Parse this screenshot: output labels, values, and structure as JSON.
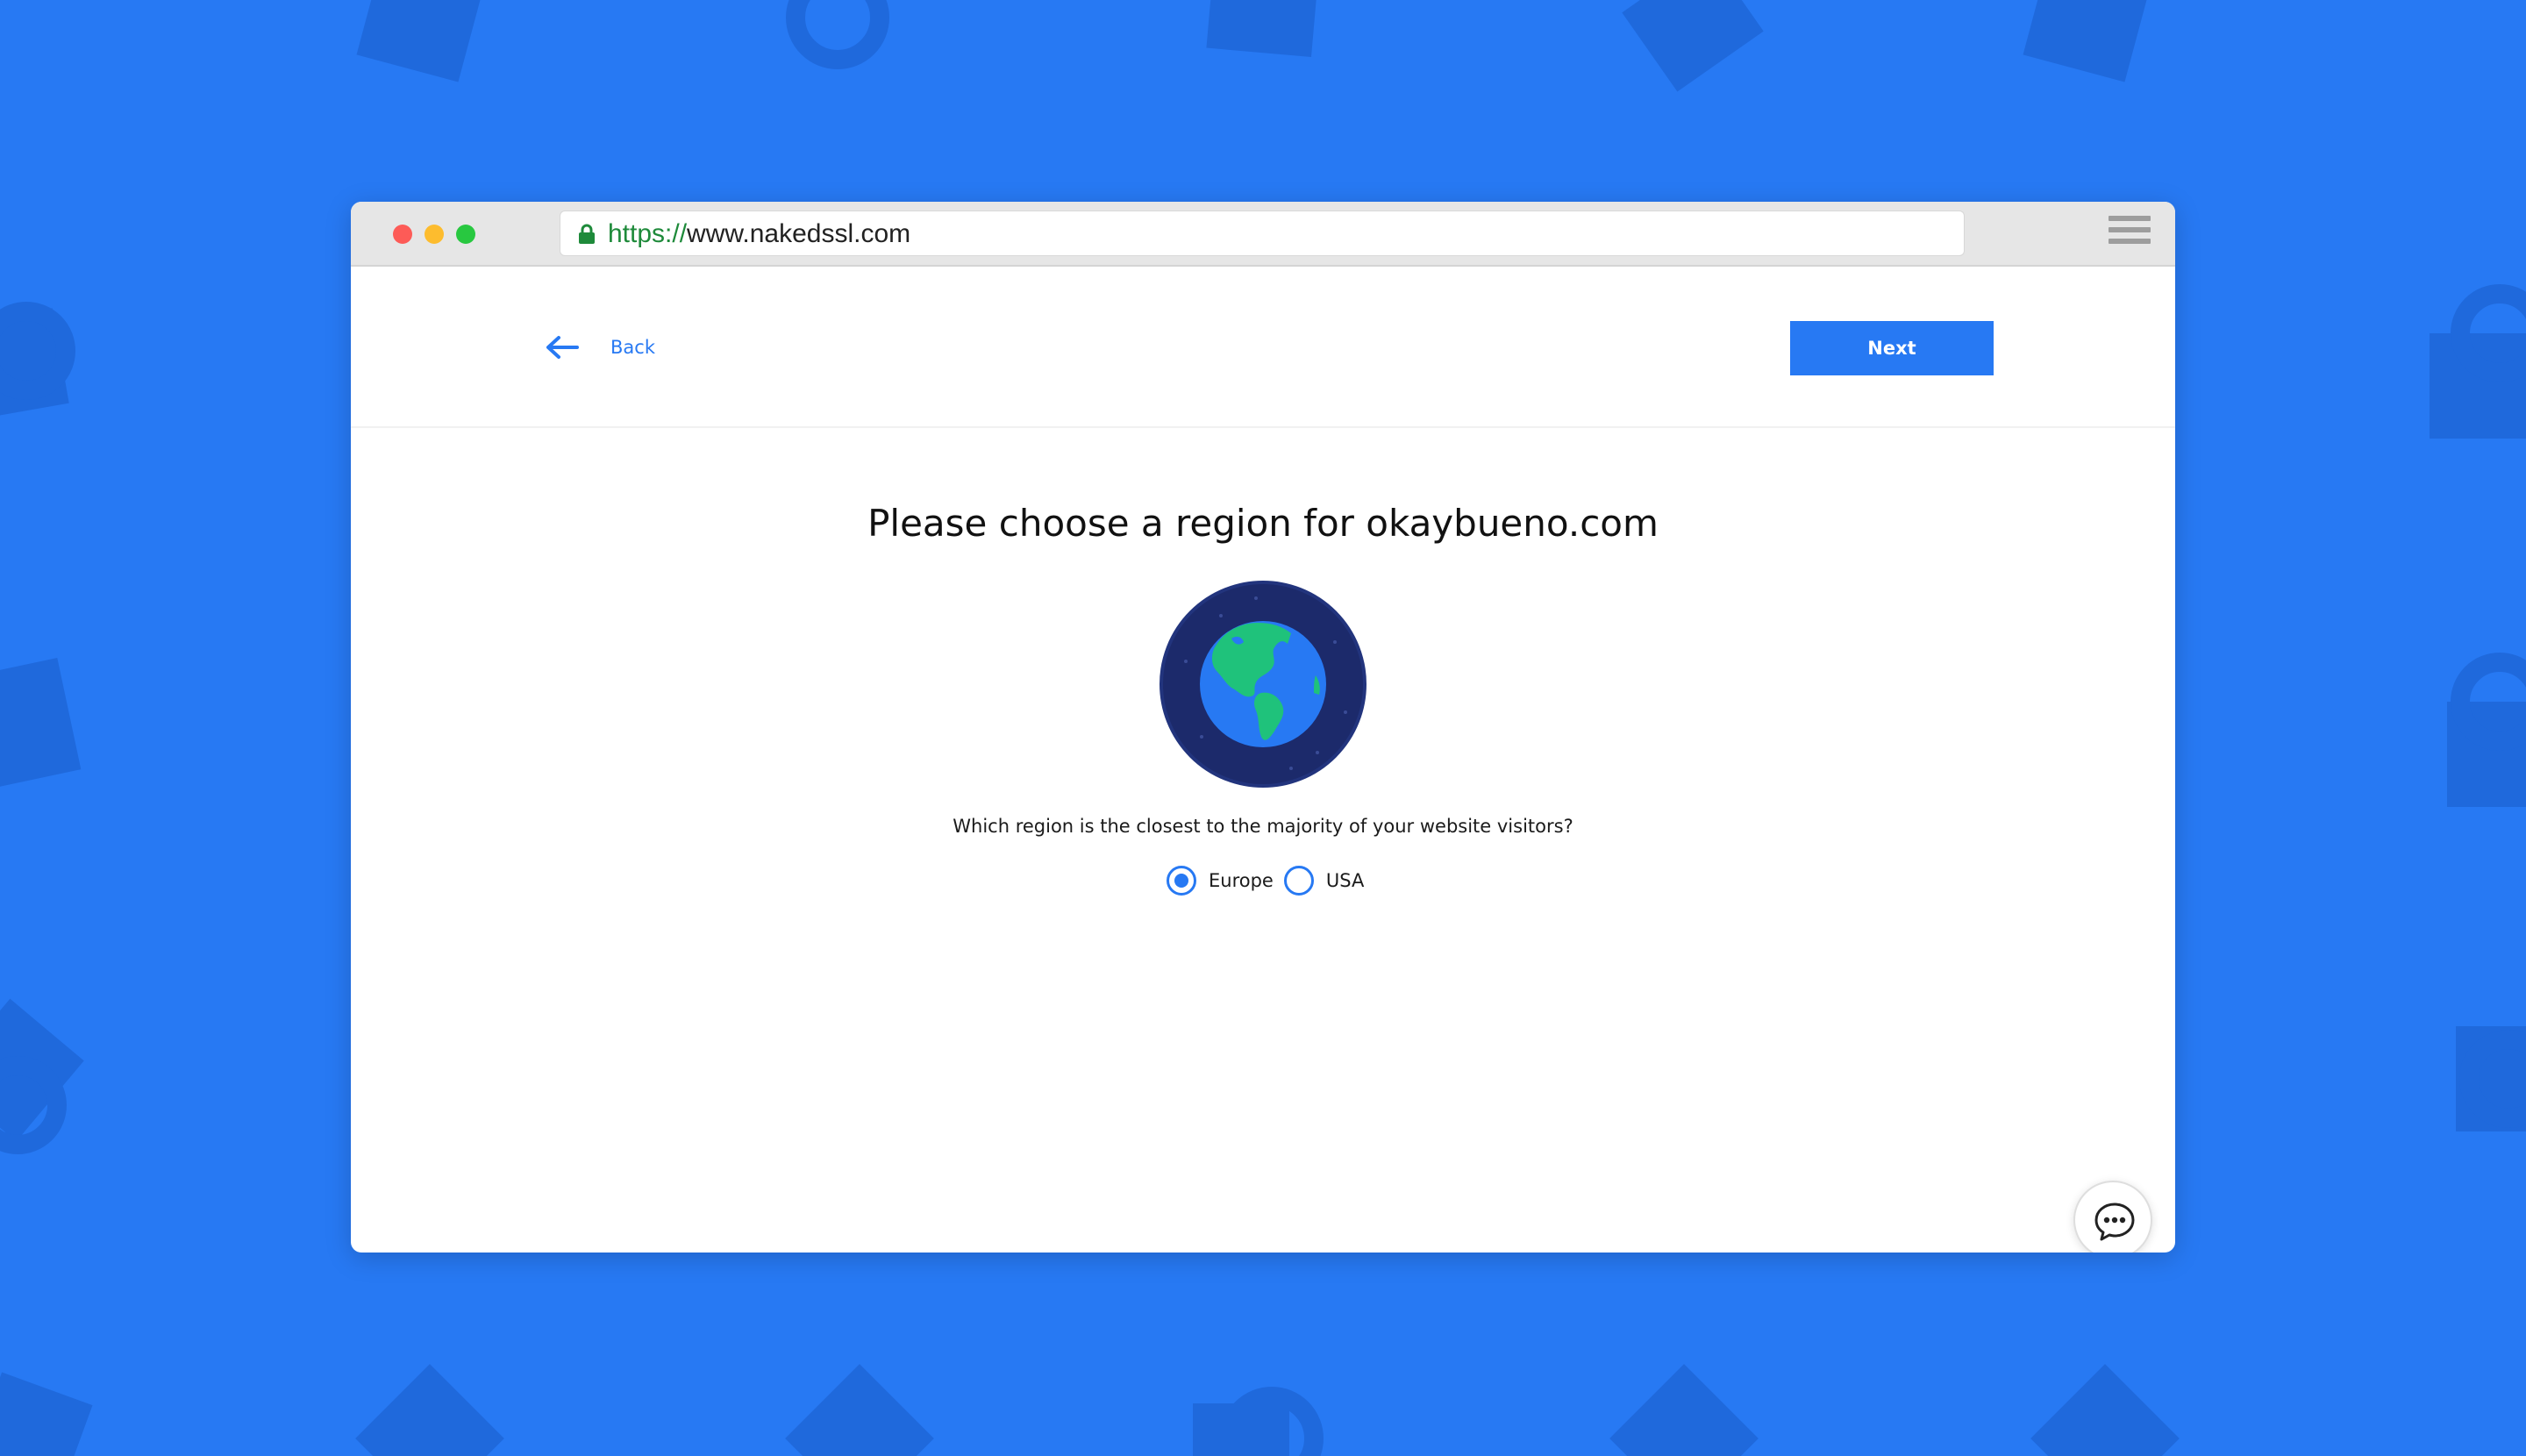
{
  "browser": {
    "url_scheme": "https://",
    "url_host": "www.nakedssl.com"
  },
  "nav": {
    "back_label": "Back",
    "next_label": "Next"
  },
  "main": {
    "title": "Please choose a region for okaybueno.com",
    "question": "Which region is the closest to the majority of your website visitors?",
    "regions": [
      {
        "label": "Europe",
        "selected": true
      },
      {
        "label": "USA",
        "selected": false
      }
    ]
  },
  "icons": {
    "lock": "lock-icon",
    "menu": "hamburger-menu-icon",
    "back": "arrow-left-icon",
    "globe": "globe-icon",
    "chat": "chat-bubble-icon"
  },
  "colors": {
    "background": "#2779f3",
    "accent": "#2779f3",
    "secure_green": "#1e8a3a"
  }
}
